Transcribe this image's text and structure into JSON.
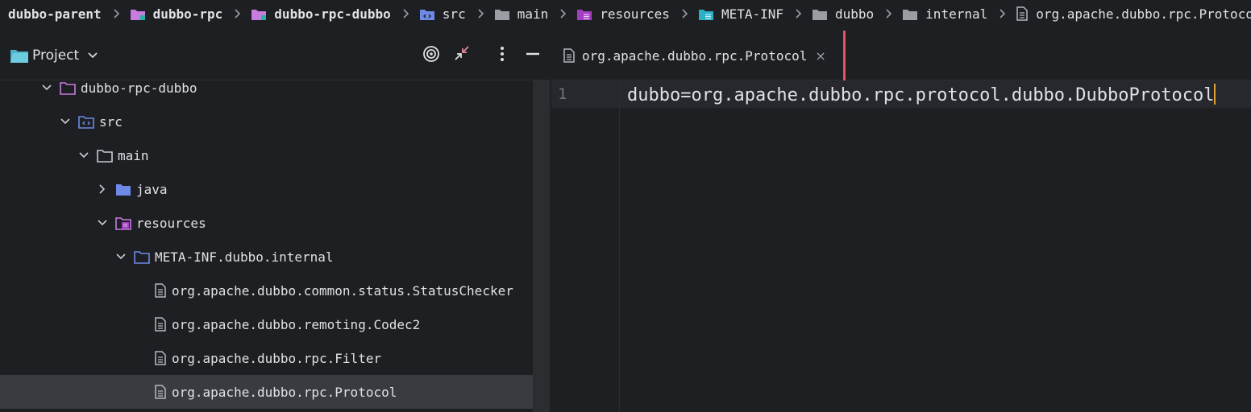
{
  "breadcrumb": [
    {
      "label": "dubbo-parent",
      "icon": "",
      "bold": true
    },
    {
      "label": "dubbo-rpc",
      "icon": "module-folder-icon",
      "bold": true
    },
    {
      "label": "dubbo-rpc-dubbo",
      "icon": "module-folder-icon",
      "bold": true
    },
    {
      "label": "src",
      "icon": "source-root-folder-icon",
      "bold": false
    },
    {
      "label": "main",
      "icon": "folder-icon",
      "bold": false
    },
    {
      "label": "resources",
      "icon": "resources-folder-icon",
      "bold": false
    },
    {
      "label": "META-INF",
      "icon": "meta-folder-icon",
      "bold": false
    },
    {
      "label": "dubbo",
      "icon": "folder-icon",
      "bold": false
    },
    {
      "label": "internal",
      "icon": "folder-icon",
      "bold": false
    },
    {
      "label": "org.apache.dubbo.rpc.Protocol",
      "icon": "text-file-icon",
      "bold": false
    }
  ],
  "project": {
    "title": "Project",
    "icons": [
      "project-folder-icon",
      "chevron-down-icon",
      "locate-target-icon",
      "collapse-all-icon",
      "more-options-icon",
      "hide-panel-icon"
    ]
  },
  "tree": [
    {
      "label": "dubbo-rpc-dubbo",
      "expanded": true,
      "icon": "module-folder-icon"
    },
    {
      "label": "src",
      "expanded": true,
      "icon": "source-root-folder-icon"
    },
    {
      "label": "main",
      "expanded": true,
      "icon": "folder-icon"
    },
    {
      "label": "java",
      "expanded": false,
      "icon": "java-source-folder-icon"
    },
    {
      "label": "resources",
      "expanded": true,
      "icon": "resources-folder-icon"
    },
    {
      "label": "META-INF.dubbo.internal",
      "expanded": true,
      "icon": "package-folder-icon"
    },
    {
      "label": "org.apache.dubbo.common.status.StatusChecker",
      "icon": "text-file-icon"
    },
    {
      "label": "org.apache.dubbo.remoting.Codec2",
      "icon": "text-file-icon"
    },
    {
      "label": "org.apache.dubbo.rpc.Filter",
      "icon": "text-file-icon"
    },
    {
      "label": "org.apache.dubbo.rpc.Protocol",
      "icon": "text-file-icon",
      "selected": true
    }
  ],
  "editor": {
    "tab_label": "org.apache.dubbo.rpc.Protocol",
    "tab_close": "×",
    "line_number": "1",
    "code_line": "dubbo=org.apache.dubbo.rpc.protocol.dubbo.DubboProtocol"
  },
  "colors": {
    "background": "#1e1f22",
    "selection": "#393b40",
    "tab_marker": "#e05561",
    "caret": "#e0a33a",
    "module_folder": "#c77dde",
    "source_folder": "#6e8ae6",
    "resources_folder": "#a43fc2",
    "meta_folder": "#2bb0c8"
  }
}
